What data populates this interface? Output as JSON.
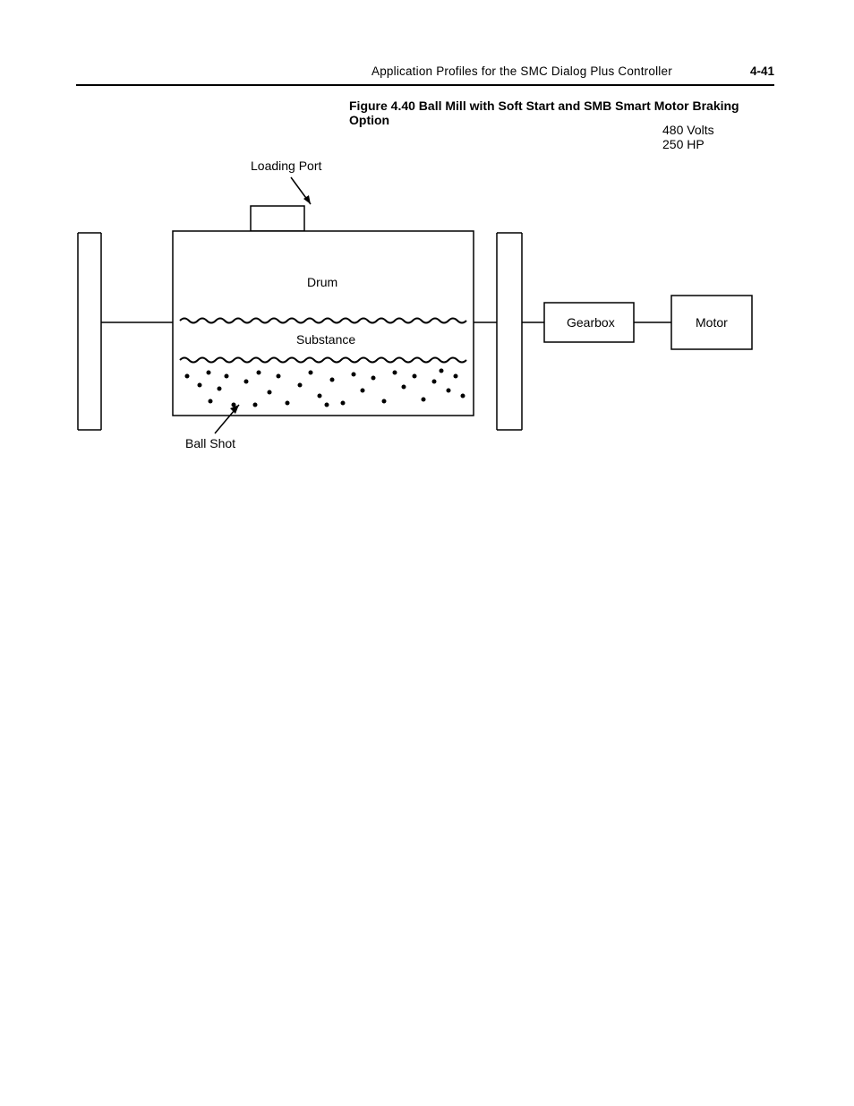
{
  "header": {
    "title": "Application Profiles for the SMC Dialog Plus Controller",
    "page": "4-41"
  },
  "figure": {
    "caption": "Figure 4.40 Ball Mill with Soft Start and SMB Smart Motor Braking Option",
    "ratings": {
      "volts": "480 Volts",
      "hp": "250 HP"
    },
    "labels": {
      "loading_port": "Loading Port",
      "drum": "Drum",
      "substance": "Substance",
      "ball_shot": "Ball Shot",
      "gearbox": "Gearbox",
      "motor": "Motor"
    }
  }
}
